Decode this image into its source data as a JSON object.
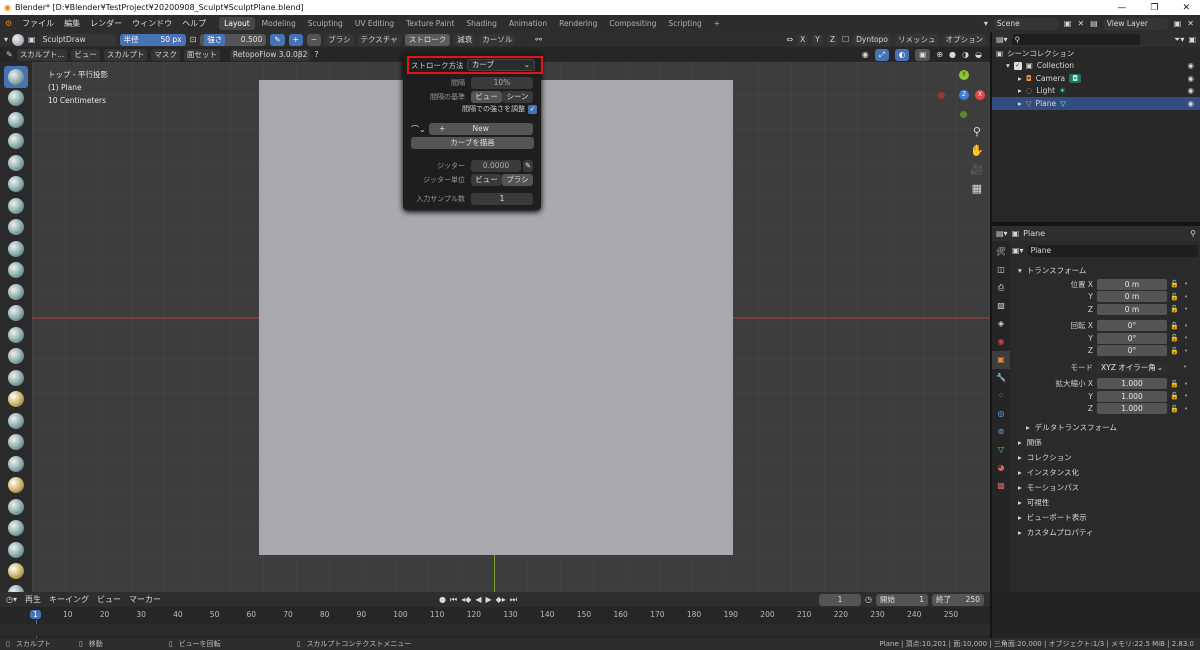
{
  "titlebar": {
    "title": "Blender* [D:¥Blender¥TestProject¥20200908_Sculpt¥SculptPlane.blend]",
    "min": "—",
    "max": "❐",
    "close": "✕"
  },
  "menu": {
    "file": "ファイル",
    "edit": "編集",
    "render": "レンダー",
    "window": "ウィンドウ",
    "help": "ヘルプ"
  },
  "workspaces": [
    "Layout",
    "Modeling",
    "Sculpting",
    "UV Editing",
    "Texture Paint",
    "Shading",
    "Animation",
    "Rendering",
    "Compositing",
    "Scripting"
  ],
  "workspace_add": "+",
  "scene": "Scene",
  "view_layer": "View Layer",
  "header": {
    "brush_name": "SculptDraw",
    "radius_label": "半径",
    "radius_value": "50 px",
    "strength_label": "強さ",
    "strength_value": "0.500",
    "plus": "+",
    "minus": "−",
    "brush": "ブラシ",
    "texture": "テクスチャ",
    "stroke": "ストローク",
    "falloff": "減衰",
    "cursor": "カーソル",
    "x": "X",
    "y": "Y",
    "z": "Z",
    "dyntopo": "Dyntopo",
    "remesh": "リメッシュ",
    "options": "オプション"
  },
  "header2": {
    "mode": "スカルプト...",
    "view": "ビュー",
    "sculpt": "スカルプト",
    "mask": "マスク",
    "face_sets": "面セット",
    "addon": "RetopoFlow 3.0.0β2",
    "help": "?"
  },
  "viewport": {
    "line1": "トップ - 平行投影",
    "line2": "(1) Plane",
    "line3": "10 Centimeters",
    "bg": "#a9a9ad"
  },
  "gizmo": {
    "y": "Y",
    "z": "Z",
    "x": "X"
  },
  "popup": {
    "stroke_method_label": "ストローク方法",
    "stroke_method_value": "カーブ",
    "spacing_label": "間隔",
    "spacing_value": "10%",
    "spacing_base_label": "間隔の基準",
    "spacing_view": "ビュー",
    "spacing_scene": "シーン",
    "adjust_label": "間隔での強さを調整",
    "new_label": "New",
    "plus": "+",
    "draw_curve": "カーブを描画",
    "jitter_label": "ジッター",
    "jitter_value": "0.0000",
    "jitter_unit_label": "ジッター単位",
    "jitter_view": "ビュー",
    "jitter_brush": "ブラシ",
    "input_samples_label": "入力サンプル数",
    "input_samples_value": "1",
    "highlight_color": "#e3131b"
  },
  "outliner": {
    "scene_collection": "シーンコレクション",
    "items": [
      {
        "label": "Collection"
      },
      {
        "label": "Camera"
      },
      {
        "label": "Light"
      },
      {
        "label": "Plane"
      }
    ]
  },
  "properties": {
    "object_name_header": "Plane",
    "object_name": "Plane",
    "transform": "トランスフォーム",
    "location_label": "位置 X",
    "rotation_label": "回転 X",
    "scale_label": "拡大縮小 X",
    "y": "Y",
    "z": "Z",
    "loc": [
      "0 m",
      "0 m",
      "0 m"
    ],
    "rot": [
      "0°",
      "0°",
      "0°"
    ],
    "scale": [
      "1.000",
      "1.000",
      "1.000"
    ],
    "mode_label": "モード",
    "mode_value": "XYZ オイラー角",
    "delta": "デルタトランスフォーム",
    "sections": [
      "関係",
      "コレクション",
      "インスタンス化",
      "モーションパス",
      "可視性",
      "ビューポート表示",
      "カスタムプロパティ"
    ]
  },
  "timeline": {
    "playback": "再生",
    "keying": "キーイング",
    "view": "ビュー",
    "marker": "マーカー",
    "current": "1",
    "start_label": "開始",
    "start": "1",
    "end_label": "終了",
    "end": "250",
    "ticks": [
      "1",
      "10",
      "20",
      "30",
      "40",
      "50",
      "60",
      "70",
      "80",
      "90",
      "100",
      "110",
      "120",
      "130",
      "140",
      "150",
      "160",
      "170",
      "180",
      "190",
      "200",
      "210",
      "220",
      "230",
      "240",
      "250"
    ]
  },
  "status": {
    "sculpt": "スカルプト",
    "move": "移動",
    "rotate": "ビューを回転",
    "context": "スカルプトコンテクストメニュー",
    "stats": "Plane | 頂点:10,201 | 面:10,000 | 三角面:20,000 | オブジェクト:1/3 | メモリ:22.5 MiB | 2.83.0"
  },
  "colors": {
    "accent": "#4772b3",
    "highlight": "#e3131b"
  }
}
